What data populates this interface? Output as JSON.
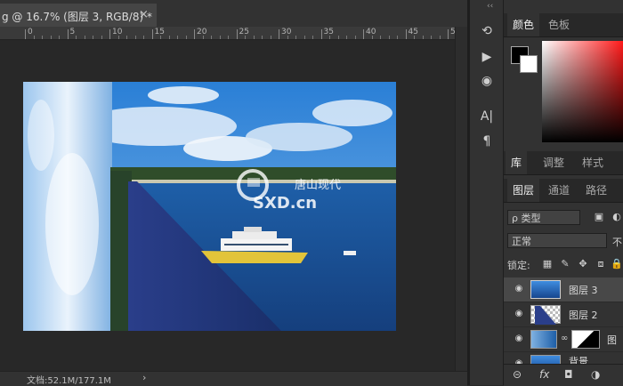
{
  "document": {
    "tab_title": "g @ 16.7% (图层 3, RGB/8) *",
    "close_glyph": "×"
  },
  "ruler": {
    "labels": [
      "0",
      "5",
      "10",
      "15",
      "20",
      "25",
      "30",
      "35",
      "40",
      "45",
      "5"
    ]
  },
  "status": {
    "doc_info": "文档:52.1M/177.1M",
    "arrow": "›"
  },
  "tools": {
    "grip": "‹‹",
    "items": [
      {
        "name": "history-icon",
        "glyph": "⟲"
      },
      {
        "name": "play-actions-icon",
        "glyph": "▶"
      },
      {
        "name": "adjust-icon",
        "glyph": "◉"
      },
      {
        "name": "character-icon",
        "glyph": "A|"
      },
      {
        "name": "paragraph-icon",
        "glyph": "¶"
      }
    ]
  },
  "color_panel": {
    "tabs": [
      "颜色",
      "色板"
    ],
    "foreground": "#000000",
    "background": "#ffffff"
  },
  "library_panel": {
    "tabs": [
      "库",
      "调整",
      "样式"
    ]
  },
  "layers_panel": {
    "tabs": [
      "图层",
      "通道",
      "路径"
    ],
    "filter_label": "ρ 类型",
    "blend_mode": "正常",
    "opacity_label": "不",
    "lock_label": "锁定:",
    "layers": [
      {
        "name": "图层 3",
        "selected": true
      },
      {
        "name": "图层 2",
        "selected": false
      },
      {
        "name": "图",
        "selected": false
      },
      {
        "name": "背景",
        "selected": false
      }
    ],
    "footer_icons": [
      "⊝",
      "fx",
      "◘",
      "◑"
    ]
  },
  "watermark": {
    "text_cn": "唐山现代",
    "text_en": "SXD.cn"
  },
  "colors": {
    "accent_blue": "#1f5fae",
    "panel_bg": "#323232"
  }
}
